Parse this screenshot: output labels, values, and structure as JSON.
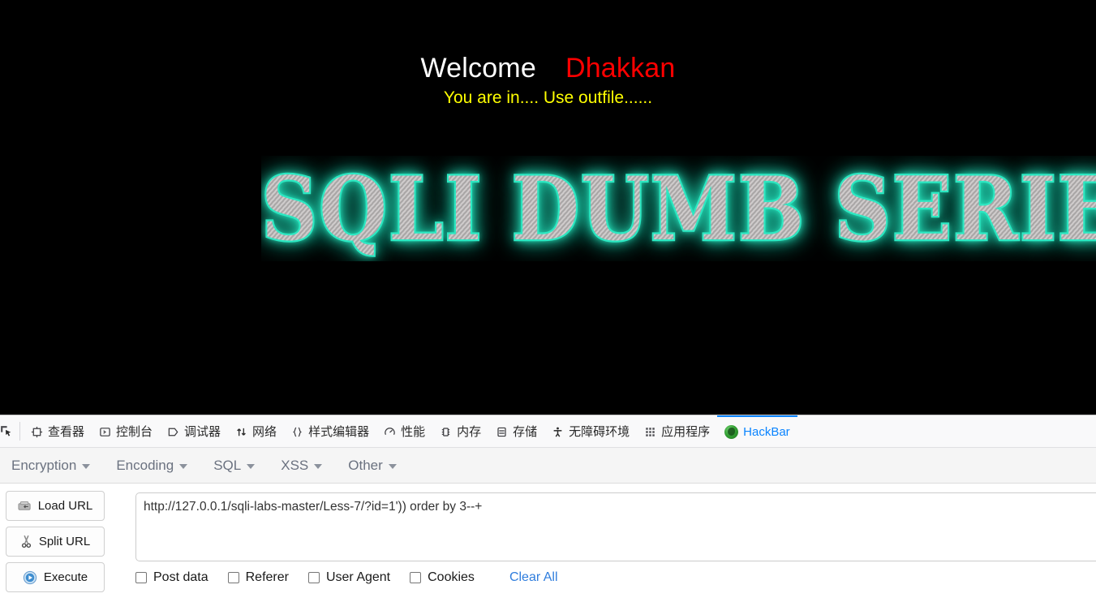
{
  "page": {
    "welcome_label": "Welcome",
    "username": "Dhakkan",
    "subtitle": "You are in.... Use outfile......",
    "banner_text": "SQLI DUMB SERIES",
    "background_color": "#000000",
    "welcome_color": "#ffffff",
    "username_color": "#ff0000",
    "subtitle_color": "#ffff00",
    "banner_glow_color": "#2ce8c2"
  },
  "devtools": {
    "picker_icon": "element-picker-icon",
    "active_tab": "HackBar",
    "accent_color": "#0a84ff",
    "tabs": [
      {
        "label": "查看器",
        "icon": "inspector-icon",
        "name": "tab-inspector"
      },
      {
        "label": "控制台",
        "icon": "console-icon",
        "name": "tab-console"
      },
      {
        "label": "调试器",
        "icon": "debugger-icon",
        "name": "tab-debugger"
      },
      {
        "label": "网络",
        "icon": "network-icon",
        "name": "tab-network"
      },
      {
        "label": "样式编辑器",
        "icon": "style-editor-icon",
        "name": "tab-style-editor"
      },
      {
        "label": "性能",
        "icon": "performance-icon",
        "name": "tab-performance"
      },
      {
        "label": "内存",
        "icon": "memory-icon",
        "name": "tab-memory"
      },
      {
        "label": "存储",
        "icon": "storage-icon",
        "name": "tab-storage"
      },
      {
        "label": "无障碍环境",
        "icon": "accessibility-icon",
        "name": "tab-accessibility"
      },
      {
        "label": "应用程序",
        "icon": "application-icon",
        "name": "tab-application"
      },
      {
        "label": "HackBar",
        "icon": "hackbar-icon",
        "name": "tab-hackbar"
      }
    ]
  },
  "hackbar": {
    "menus": [
      {
        "label": "Encryption"
      },
      {
        "label": "Encoding"
      },
      {
        "label": "SQL"
      },
      {
        "label": "XSS"
      },
      {
        "label": "Other"
      }
    ],
    "buttons": [
      {
        "label": "Load URL",
        "icon": "load-url-icon"
      },
      {
        "label": "Split URL",
        "icon": "scissors-icon"
      },
      {
        "label": "Execute",
        "icon": "play-icon"
      }
    ],
    "url_value": "http://127.0.0.1/sqli-labs-master/Less-7/?id=1')) order by 3--+",
    "url_placeholder": "",
    "options": [
      {
        "label": "Post data",
        "checked": false
      },
      {
        "label": "Referer",
        "checked": false
      },
      {
        "label": "User Agent",
        "checked": false
      },
      {
        "label": "Cookies",
        "checked": false
      }
    ],
    "clear_all_label": "Clear All",
    "link_color": "#2f7ddd"
  }
}
